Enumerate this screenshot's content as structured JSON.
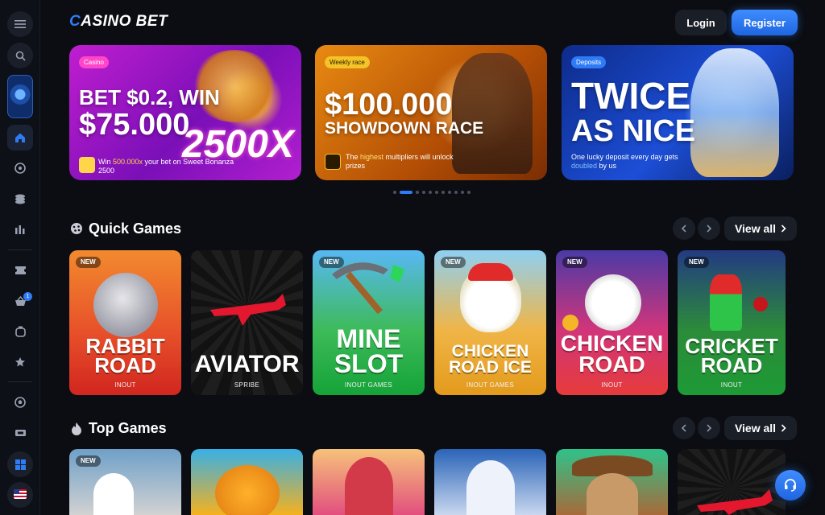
{
  "header": {
    "logo_main": "ASINO BET",
    "logo_c": "C",
    "login_label": "Login",
    "register_label": "Register"
  },
  "sidebar": {
    "items": [
      {
        "icon": "menu-icon"
      },
      {
        "icon": "search-icon"
      },
      {
        "icon": "promo-tile"
      },
      {
        "icon": "home-icon"
      },
      {
        "icon": "sports-icon"
      },
      {
        "icon": "casino-chips-icon"
      },
      {
        "icon": "stats-icon"
      },
      {
        "icon": "ticket-icon"
      },
      {
        "icon": "basket-icon",
        "badge": "1"
      },
      {
        "icon": "tv-icon"
      },
      {
        "icon": "star-icon"
      },
      {
        "icon": "soccer-icon"
      },
      {
        "icon": "coupon-icon"
      },
      {
        "icon": "windows-icon"
      },
      {
        "icon": "us-flag-icon"
      }
    ]
  },
  "banners": [
    {
      "tag": "Casino",
      "title_line1": "BET $0.2, WIN",
      "title_line2": "$75.000",
      "multiplier": "2500X",
      "sub_prefix": "Win ",
      "sub_highlight": "500.000x",
      "sub_suffix": " your bet on Sweet Bonanza 2500"
    },
    {
      "tag": "Weekly race",
      "title_line1": "$100.000",
      "title_line2": "SHOWDOWN RACE",
      "sub_prefix": "The ",
      "sub_highlight": "highest",
      "sub_suffix": " multipliers will unlock prizes"
    },
    {
      "tag": "Deposits",
      "title_line1": "TWICE",
      "title_line2": "AS NICE",
      "sub_prefix": "One lucky deposit every day gets ",
      "sub_highlight": "doubled",
      "sub_suffix": " by us"
    }
  ],
  "carousel": {
    "dot_count": 11,
    "active_index": 1
  },
  "quick_games": {
    "title": "Quick Games",
    "view_all": "View all",
    "games": [
      {
        "name": "RABBIT\nROAD",
        "provider": "INOUT",
        "new": "NEW"
      },
      {
        "name": "AVIATOR",
        "provider": "SPRIBE",
        "new": ""
      },
      {
        "name": "MINE\nSLOT",
        "provider": "INOUT GAMES",
        "new": "NEW"
      },
      {
        "name": "CHICKEN\nROAD ICE",
        "provider": "INOUT GAMES",
        "new": "NEW"
      },
      {
        "name": "CHICKEN\nROAD",
        "provider": "INOUT",
        "new": "NEW"
      },
      {
        "name": "CRICKET\nROAD",
        "provider": "INOUT",
        "new": "NEW"
      }
    ]
  },
  "top_games": {
    "title": "Top Games",
    "view_all": "View all",
    "games": [
      {
        "new": "NEW"
      },
      {
        "new": ""
      },
      {
        "new": ""
      },
      {
        "new": ""
      },
      {
        "new": ""
      },
      {
        "new": ""
      }
    ]
  },
  "colors": {
    "accent": "#2f7bf5",
    "background": "#0b0d12",
    "panel": "#1a1e27"
  }
}
